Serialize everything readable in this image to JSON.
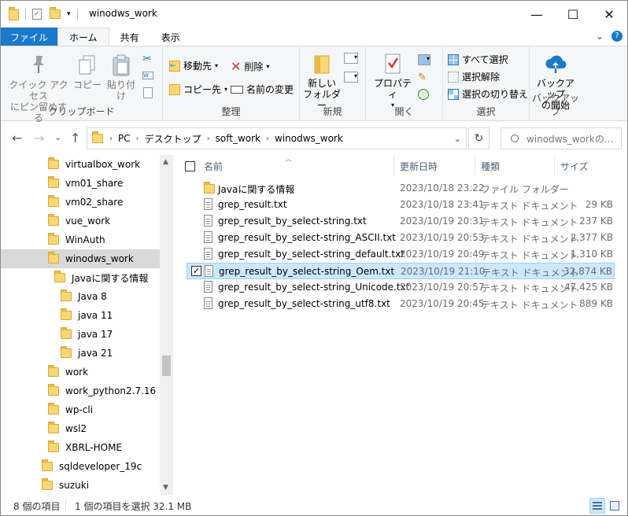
{
  "window": {
    "title": "winodws_work",
    "minimize": "—",
    "maximize": "☐",
    "close": "✕"
  },
  "tabs": {
    "file": "ファイル",
    "home": "ホーム",
    "share": "共有",
    "view": "表示",
    "expand": "⌄",
    "help": "?"
  },
  "ribbon": {
    "clipboard": {
      "pin": "クイック アクセス にピン留めする",
      "pin_l1": "クイック アクセス",
      "pin_l2": "にピン留めする",
      "copy": "コピー",
      "paste": "貼り付け",
      "label": "クリップボード"
    },
    "organize": {
      "move_to": "移動先",
      "copy_to": "コピー先",
      "delete": "削除",
      "rename": "名前の変更",
      "label": "整理"
    },
    "new": {
      "new_folder_l1": "新しい",
      "new_folder_l2": "フォルダー",
      "label": "新規"
    },
    "open": {
      "properties": "プロパティ",
      "label": "開く"
    },
    "select": {
      "select_all": "すべて選択",
      "select_none": "選択解除",
      "invert": "選択の切り替え",
      "label": "選択"
    },
    "backup": {
      "backup_l1": "バックアップ",
      "backup_l2": "の開始",
      "label": "バックアップ"
    }
  },
  "address": {
    "back": "←",
    "forward": "→",
    "recent": "⌄",
    "up": "↑",
    "crumbs": [
      "PC",
      "デスクトップ",
      "soft_work",
      "winodws_work"
    ],
    "dropdown": "⌄",
    "refresh": "↻",
    "search_placeholder": "winodws_workの..."
  },
  "navpane": {
    "items": [
      {
        "label": "virtualbox_work"
      },
      {
        "label": "vm01_share"
      },
      {
        "label": "vm02_share"
      },
      {
        "label": "vue_work"
      },
      {
        "label": "WinAuth"
      },
      {
        "label": "winodws_work"
      },
      {
        "label": "Javaに関する情報"
      },
      {
        "label": "Java 8"
      },
      {
        "label": "java 11"
      },
      {
        "label": "java 17"
      },
      {
        "label": "java 21"
      },
      {
        "label": "work"
      },
      {
        "label": "work_python2.7.16"
      },
      {
        "label": "wp-cli"
      },
      {
        "label": "wsl2"
      },
      {
        "label": "XBRL-HOME"
      },
      {
        "label": "sqldeveloper_19c"
      },
      {
        "label": "suzuki"
      }
    ]
  },
  "columns": {
    "name": "名前",
    "date": "更新日時",
    "type": "種類",
    "size": "サイズ"
  },
  "files": [
    {
      "name": "Javaに関する情報",
      "date": "2023/10/18 23:22",
      "type": "ファイル フォルダー",
      "size": ""
    },
    {
      "name": "grep_result.txt",
      "date": "2023/10/18 23:41",
      "type": "テキスト ドキュメント",
      "size": "29 KB"
    },
    {
      "name": "grep_result_by_select-string.txt",
      "date": "2023/10/19 20:31",
      "type": "テキスト ドキュメント",
      "size": "237 KB"
    },
    {
      "name": "grep_result_by_select-string_ASCII.txt",
      "date": "2023/10/19 20:53",
      "type": "テキスト ドキュメント",
      "size": "2,377 KB"
    },
    {
      "name": "grep_result_by_select-string_default.txt",
      "date": "2023/10/19 20:49",
      "type": "テキスト ドキュメント",
      "size": "1,310 KB"
    },
    {
      "name": "grep_result_by_select-string_Oem.txt",
      "date": "2023/10/19 21:10",
      "type": "テキスト ドキュメント",
      "size": "32,874 KB"
    },
    {
      "name": "grep_result_by_select-string_Unicode.txt",
      "date": "2023/10/19 20:57",
      "type": "テキスト ドキュメント",
      "size": "47,425 KB"
    },
    {
      "name": "grep_result_by_select-string_utf8.txt",
      "date": "2023/10/19 20:45",
      "type": "テキスト ドキュメント",
      "size": "889 KB"
    }
  ],
  "status": {
    "count": "8 個の項目",
    "selection": "1 個の項目を選択 32.1 MB"
  },
  "icons": {
    "file_checkbox_checked": "✓"
  }
}
